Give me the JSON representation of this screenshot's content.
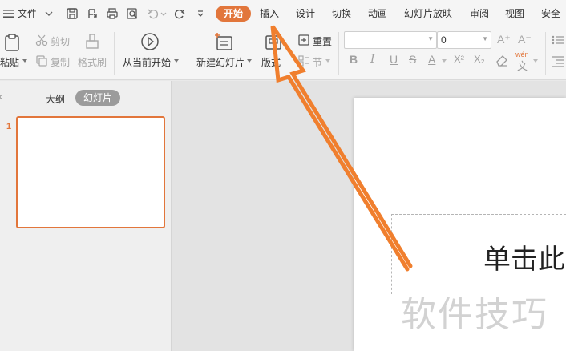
{
  "menu": {
    "file_label": "文件",
    "tabs": [
      "开始",
      "插入",
      "设计",
      "切换",
      "动画",
      "幻灯片放映",
      "审阅",
      "视图",
      "安全"
    ]
  },
  "ribbon": {
    "paste": "粘贴",
    "cut": "剪切",
    "copy": "复制",
    "format_painter": "格式刷",
    "play_from_current": "从当前开始",
    "new_slide": "新建幻灯片",
    "layout": "版式",
    "reset": "重置",
    "section": "节",
    "font_name": "",
    "font_size": "0",
    "font_bigger": "A⁺",
    "font_smaller": "A⁻",
    "bold": "B",
    "italic": "I",
    "underline": "U",
    "strike": "S",
    "font_color": "A",
    "superscript": "X²",
    "subscript": "X₂",
    "pinyin_top": "wén",
    "pinyin_bottom": "文"
  },
  "panel": {
    "outline_tab": "大纲",
    "slides_tab": "幻灯片",
    "slide_number": "1"
  },
  "slide": {
    "placeholder_text": "单击此"
  },
  "watermark": "软件技巧",
  "colors": {
    "accent": "#e2763b",
    "arrow": "#f07f2e"
  }
}
